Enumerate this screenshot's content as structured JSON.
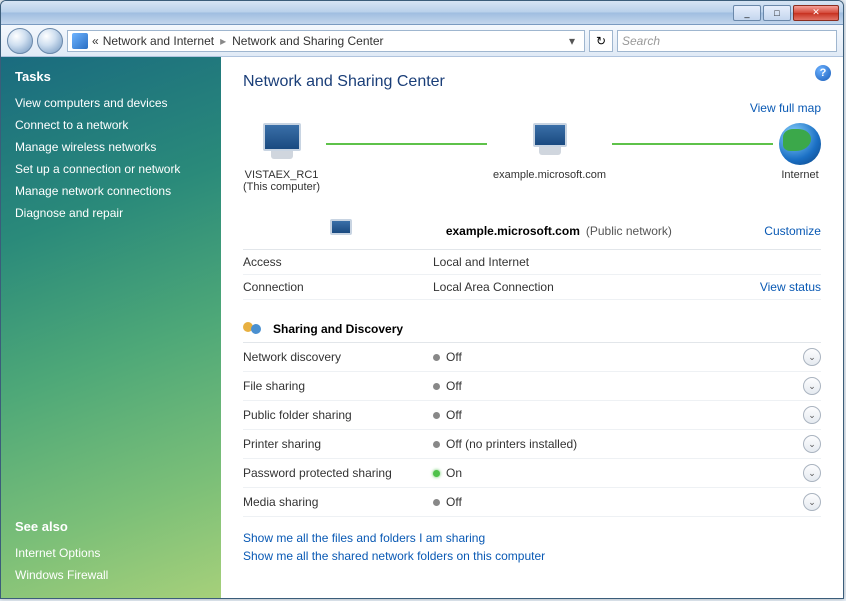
{
  "titlebar": {
    "min": "_",
    "max": "□",
    "close": "✕"
  },
  "address": {
    "root": "Network and Internet",
    "current": "Network and Sharing Center",
    "search_placeholder": "Search"
  },
  "sidebar": {
    "tasks_heading": "Tasks",
    "tasks": [
      "View computers and devices",
      "Connect to a network",
      "Manage wireless networks",
      "Set up a connection or network",
      "Manage network connections",
      "Diagnose and repair"
    ],
    "seealso_heading": "See also",
    "seealso": [
      "Internet Options",
      "Windows Firewall"
    ]
  },
  "content": {
    "title": "Network and Sharing Center",
    "view_full_map": "View full map",
    "map": {
      "this_pc": "VISTAEX_RC1",
      "this_pc_sub": "(This computer)",
      "network": "example.microsoft.com",
      "internet": "Internet"
    },
    "network_section": {
      "name": "example.microsoft.com",
      "type": "(Public network)",
      "customize": "Customize",
      "rows": [
        {
          "label": "Access",
          "value": "Local and Internet",
          "right": ""
        },
        {
          "label": "Connection",
          "value": "Local Area Connection",
          "right": "View status"
        }
      ]
    },
    "sharing": {
      "heading": "Sharing and Discovery",
      "items": [
        {
          "label": "Network discovery",
          "value": "Off",
          "on": false
        },
        {
          "label": "File sharing",
          "value": "Off",
          "on": false
        },
        {
          "label": "Public folder sharing",
          "value": "Off",
          "on": false
        },
        {
          "label": "Printer sharing",
          "value": "Off (no printers installed)",
          "on": false
        },
        {
          "label": "Password protected sharing",
          "value": "On",
          "on": true
        },
        {
          "label": "Media sharing",
          "value": "Off",
          "on": false
        }
      ]
    },
    "bottom_links": [
      "Show me all the files and folders I am sharing",
      "Show me all the shared network folders on this computer"
    ]
  }
}
